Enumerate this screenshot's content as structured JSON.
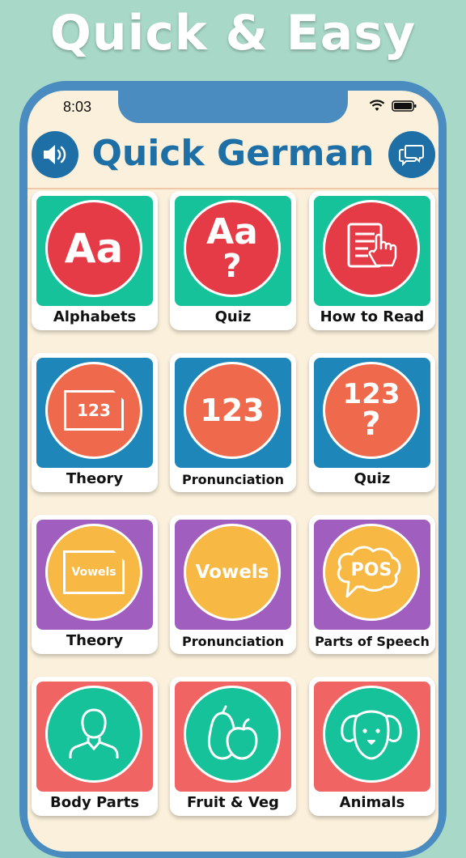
{
  "headline": "Quick & Easy",
  "status_bar": {
    "time": "8:03"
  },
  "header": {
    "title": "Quick German",
    "speaker_icon": "speaker-icon",
    "feedback_icon": "chat-bubbles-icon"
  },
  "colors": {
    "background": "#a8d8c8",
    "phone_frame": "#4a8cc0",
    "screen": "#fbf0db",
    "title_blue": "#1e6fa6",
    "teal": "#16c29a",
    "blue": "#1e86b8",
    "purple": "#a05fbf",
    "coral": "#f06464",
    "red_circle": "#e53b47",
    "orange_circle": "#ef6a4c",
    "yellow_circle": "#f7b844",
    "green_circle": "#16c29a"
  },
  "cards": [
    {
      "label": "Alphabets",
      "circle_text": "Aa",
      "icon": "alphabet-icon"
    },
    {
      "label": "Quiz",
      "circle_text": "Aa",
      "circle_sub": "?",
      "icon": "alphabet-quiz-icon"
    },
    {
      "label": "How to Read",
      "icon": "document-hand-icon"
    },
    {
      "label": "Theory",
      "circle_text": "123",
      "icon": "number-card-icon"
    },
    {
      "label": "Pronunciation",
      "circle_text": "123",
      "icon": "number-icon"
    },
    {
      "label": "Quiz",
      "circle_text": "123",
      "circle_sub": "?",
      "icon": "number-quiz-icon"
    },
    {
      "label": "Theory",
      "circle_text": "Vowels",
      "icon": "vowels-card-icon"
    },
    {
      "label": "Pronunciation",
      "circle_text": "Vowels",
      "icon": "vowels-icon"
    },
    {
      "label": "Parts of Speech",
      "circle_text": "POS",
      "icon": "speech-bubble-icon"
    },
    {
      "label": "Body Parts",
      "icon": "person-icon"
    },
    {
      "label": "Fruit & Veg",
      "icon": "fruit-icon"
    },
    {
      "label": "Animals",
      "icon": "dog-icon"
    }
  ]
}
